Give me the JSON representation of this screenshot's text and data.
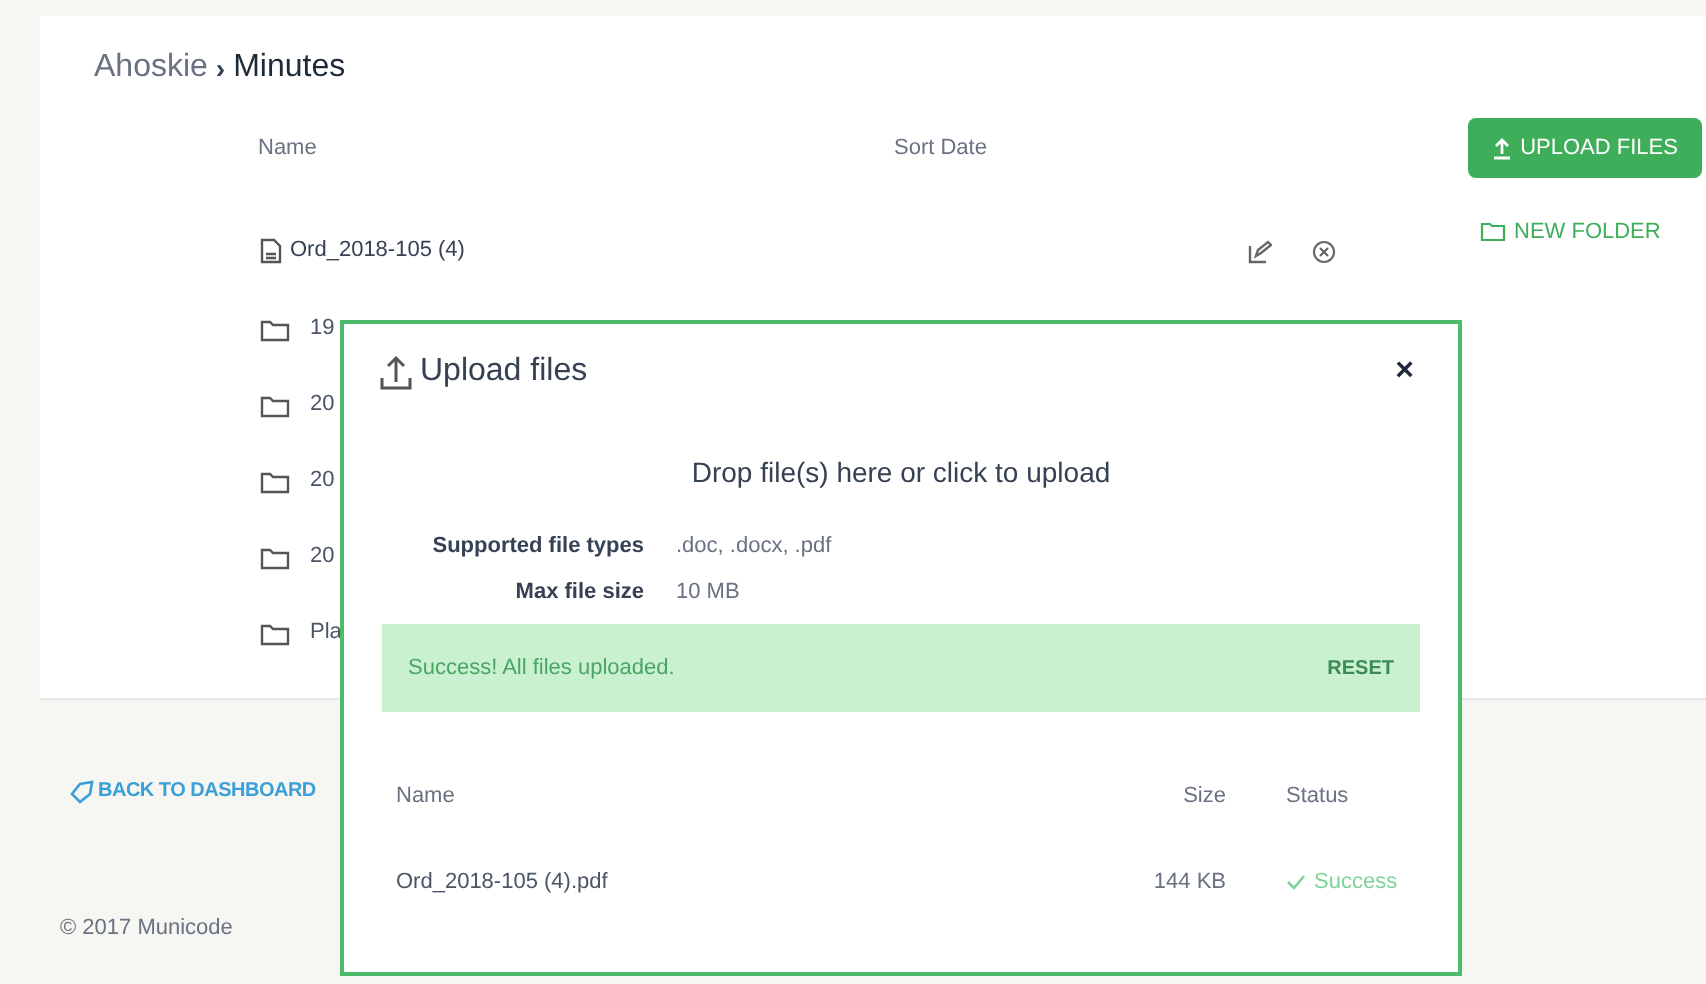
{
  "breadcrumb": [
    {
      "label": "Ahoskie",
      "selected": false
    },
    {
      "label": "Minutes",
      "selected": true
    }
  ],
  "breadcrumb_separator": "›",
  "columns": [
    "Name",
    "Sort Date"
  ],
  "items": [
    {
      "kind": "file",
      "name": "Ord_2018-105 (4)"
    },
    {
      "kind": "folder",
      "name": "19"
    },
    {
      "kind": "folder",
      "name": "20"
    },
    {
      "kind": "folder",
      "name": "20"
    },
    {
      "kind": "folder",
      "name": "20"
    },
    {
      "kind": "folder",
      "name": "Pla"
    }
  ],
  "actions": {
    "upload": "UPLOAD FILES",
    "new_folder": "NEW FOLDER"
  },
  "back_link": "BACK TO DASHBOARD",
  "footer": "© 2017 Municode",
  "dialog": {
    "title": "Upload files",
    "close": "×",
    "drop_text": "Drop file(s) here or click to upload",
    "info": [
      {
        "label": "Supported file types",
        "value": ".doc, .docx, .pdf"
      },
      {
        "label": "Max file size",
        "value": "10 MB"
      }
    ],
    "alert": {
      "message": "Success! All files uploaded.",
      "action": "RESET"
    },
    "columns": [
      "Name",
      "Size",
      "Status"
    ],
    "rows": [
      {
        "name": "Ord_2018-105 (4).pdf",
        "size": "144 KB",
        "status": "Success"
      }
    ]
  }
}
